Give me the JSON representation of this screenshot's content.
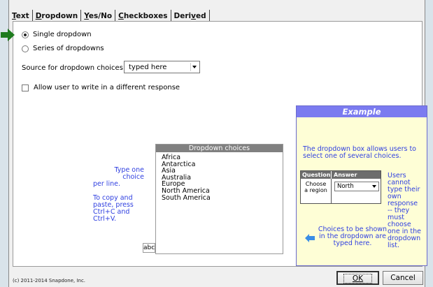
{
  "tabs": [
    {
      "label_pre": "",
      "label_u": "T",
      "label_post": "ext"
    },
    {
      "label_pre": "",
      "label_u": "D",
      "label_post": "ropdown"
    },
    {
      "label_pre": "",
      "label_u": "Y",
      "label_post": "es/No"
    },
    {
      "label_pre": "",
      "label_u": "C",
      "label_post": "heckboxes"
    },
    {
      "label_pre": "Deri",
      "label_u": "v",
      "label_post": "ed"
    }
  ],
  "options": {
    "single": "Single dropdown",
    "series": "Series of dropdowns",
    "selected": "single"
  },
  "source": {
    "label": "Source for dropdown choices:",
    "value": "typed here"
  },
  "allow_write": {
    "label": "Allow user to write in a different response",
    "checked": false
  },
  "choices": {
    "header": "Dropdown choices",
    "items": [
      "Africa",
      "Antarctica",
      "Asia",
      "Australia",
      "Europe",
      "North America",
      "South America"
    ]
  },
  "help": {
    "line1": "Type one choice",
    "line2": "per line.",
    "line3": "To copy and",
    "line4": "paste, press",
    "line5": "Ctrl+C and",
    "line6": "Ctrl+V."
  },
  "abc_button": "abc",
  "example": {
    "title": "Example",
    "intro1": "The dropdown box allows users to",
    "intro2": "select one of several choices.",
    "col_question": "Question",
    "col_answer": "Answer",
    "q1": "Choose",
    "q2": "a region",
    "answer_value": "North",
    "side": [
      "Users",
      "cannot",
      "type their",
      "own",
      "response",
      "-- they",
      "must",
      "choose",
      "one in the",
      "dropdown",
      "list."
    ],
    "note1": "Choices to be shown",
    "note2": "in the dropdown are",
    "note3": "typed here."
  },
  "footer": "(c) 2011-2014 Snapdone, Inc.",
  "buttons": {
    "ok": "OK",
    "cancel": "Cancel"
  },
  "colors": {
    "accent": "#7b7bf0",
    "help_text": "#2f3fe0",
    "example_bg": "#fefed6",
    "arrow_green": "#1e7b1e"
  }
}
